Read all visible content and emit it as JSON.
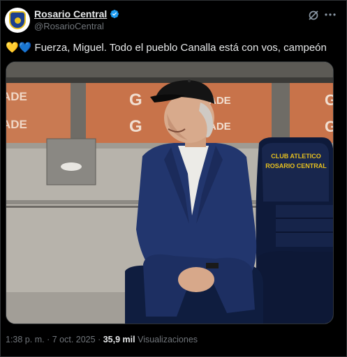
{
  "tweet": {
    "author_name": "Rosario Central",
    "author_handle": "@RosarioCentral",
    "emojis": "💛💙",
    "text": "Fuerza, Miguel. Todo el pueblo Canalla está con vos, campeón",
    "photo": {
      "banner_text_1": "ADE",
      "banner_text_2": "G",
      "banner_text_3": "ADE",
      "seat_text_line1": "CLUB ATLETICO",
      "seat_text_line2": "ROSARIO CENTRAL"
    },
    "time": "1:38 p. m.",
    "separator": "·",
    "date": "7 oct. 2025",
    "views_count": "35,9 mil",
    "views_label": "Visualizaciones"
  },
  "colors": {
    "verified": "#1d9bf0",
    "accent_blue": "#1d9bf0",
    "text_secondary": "#71767b"
  }
}
